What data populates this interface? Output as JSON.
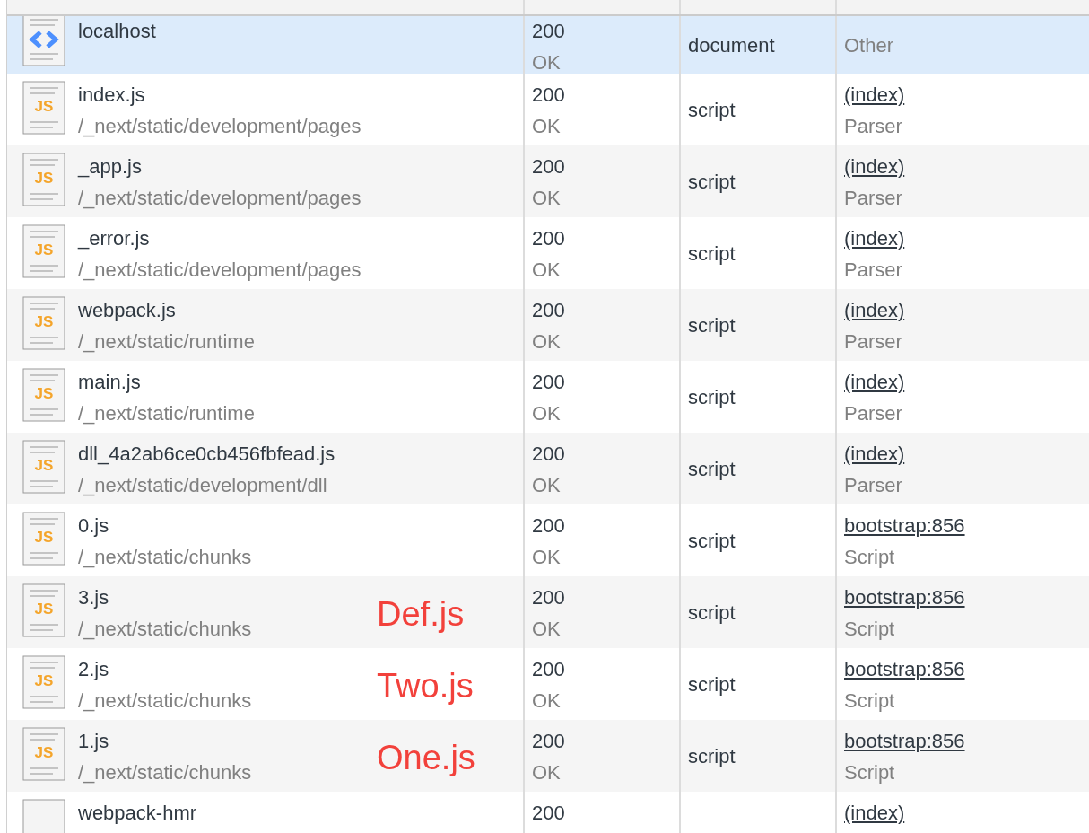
{
  "rows": [
    {
      "kind": "document",
      "name": "localhost",
      "path": "",
      "status": "200",
      "status_text": "OK",
      "type": "document",
      "initiator": {
        "text": "Other",
        "link": false
      },
      "initiator_detail": "",
      "selected": true
    },
    {
      "kind": "script",
      "icon_text": "JS",
      "name": "index.js",
      "path": "/_next/static/development/pages",
      "status": "200",
      "status_text": "OK",
      "type": "script",
      "initiator": {
        "text": "(index)",
        "link": true
      },
      "initiator_detail": "Parser",
      "selected": false
    },
    {
      "kind": "script",
      "icon_text": "JS",
      "name": "_app.js",
      "path": "/_next/static/development/pages",
      "status": "200",
      "status_text": "OK",
      "type": "script",
      "initiator": {
        "text": "(index)",
        "link": true
      },
      "initiator_detail": "Parser",
      "selected": false
    },
    {
      "kind": "script",
      "icon_text": "JS",
      "name": "_error.js",
      "path": "/_next/static/development/pages",
      "status": "200",
      "status_text": "OK",
      "type": "script",
      "initiator": {
        "text": "(index)",
        "link": true
      },
      "initiator_detail": "Parser",
      "selected": false
    },
    {
      "kind": "script",
      "icon_text": "JS",
      "name": "webpack.js",
      "path": "/_next/static/runtime",
      "status": "200",
      "status_text": "OK",
      "type": "script",
      "initiator": {
        "text": "(index)",
        "link": true
      },
      "initiator_detail": "Parser",
      "selected": false
    },
    {
      "kind": "script",
      "icon_text": "JS",
      "name": "main.js",
      "path": "/_next/static/runtime",
      "status": "200",
      "status_text": "OK",
      "type": "script",
      "initiator": {
        "text": "(index)",
        "link": true
      },
      "initiator_detail": "Parser",
      "selected": false
    },
    {
      "kind": "script",
      "icon_text": "JS",
      "name": "dll_4a2ab6ce0cb456fbfead.js",
      "path": "/_next/static/development/dll",
      "status": "200",
      "status_text": "OK",
      "type": "script",
      "initiator": {
        "text": "(index)",
        "link": true
      },
      "initiator_detail": "Parser",
      "selected": false
    },
    {
      "kind": "script",
      "icon_text": "JS",
      "name": "0.js",
      "path": "/_next/static/chunks",
      "status": "200",
      "status_text": "OK",
      "type": "script",
      "initiator": {
        "text": "bootstrap:856",
        "link": true
      },
      "initiator_detail": "Script",
      "selected": false
    },
    {
      "kind": "script",
      "icon_text": "JS",
      "name": "3.js",
      "path": "/_next/static/chunks",
      "annotation": "Def.js",
      "status": "200",
      "status_text": "OK",
      "type": "script",
      "initiator": {
        "text": "bootstrap:856",
        "link": true
      },
      "initiator_detail": "Script",
      "selected": false
    },
    {
      "kind": "script",
      "icon_text": "JS",
      "name": "2.js",
      "path": "/_next/static/chunks",
      "annotation": "Two.js",
      "status": "200",
      "status_text": "OK",
      "type": "script",
      "initiator": {
        "text": "bootstrap:856",
        "link": true
      },
      "initiator_detail": "Script",
      "selected": false
    },
    {
      "kind": "script",
      "icon_text": "JS",
      "name": "1.js",
      "path": "/_next/static/chunks",
      "annotation": "One.js",
      "status": "200",
      "status_text": "OK",
      "type": "script",
      "initiator": {
        "text": "bootstrap:856",
        "link": true
      },
      "initiator_detail": "Script",
      "selected": false
    },
    {
      "kind": "blank",
      "name": "webpack-hmr",
      "path": "",
      "status": "200",
      "status_text": "",
      "type": "",
      "initiator": {
        "text": "(index)",
        "link": true
      },
      "initiator_detail": "",
      "selected": false
    }
  ]
}
